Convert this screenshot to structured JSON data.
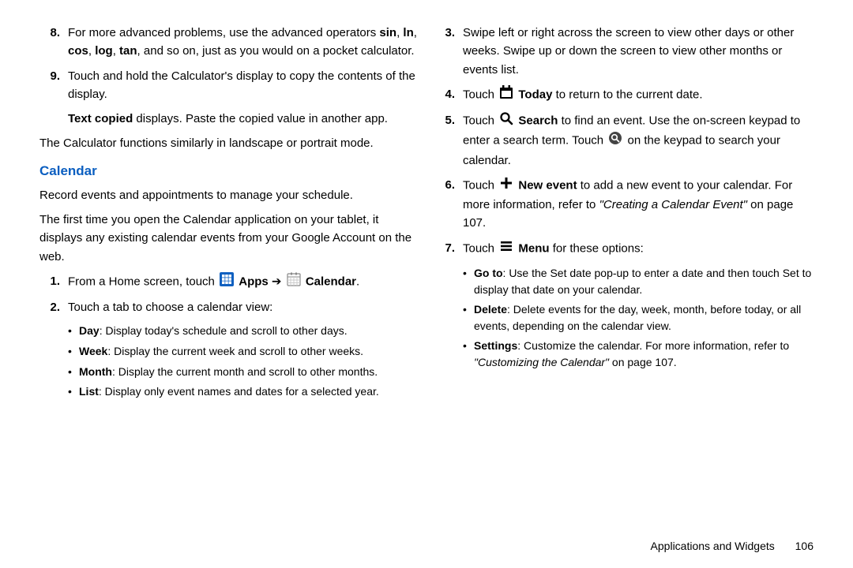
{
  "left": {
    "item8": {
      "num": "8.",
      "t1": "For more advanced problems, use the advanced operators ",
      "op1": "sin",
      "c1": ", ",
      "op2": "ln",
      "c2": ", ",
      "op3": "cos",
      "c3": ", ",
      "op4": "log",
      "c4": ", ",
      "op5": "tan",
      "t2": ", and so on, just as you would on a pocket calculator."
    },
    "item9": {
      "num": "9.",
      "text": "Touch and hold the Calculator's display to copy the contents of the display.",
      "sub_b": "Text copied",
      "sub_t": " displays. Paste the copied value in another app."
    },
    "landscape": "The Calculator functions similarly in landscape or portrait mode.",
    "heading": "Calendar",
    "desc1": "Record events and appointments to manage your schedule.",
    "desc2": "The first time you open the Calendar application on your tablet, it displays any existing calendar events from your Google Account on the web.",
    "step1": {
      "num": "1.",
      "t1": "From a Home screen, touch ",
      "apps": " Apps",
      "arrow": " ➔ ",
      "cal": " Calendar",
      "dot": "."
    },
    "step2": {
      "num": "2.",
      "text": "Touch a tab to choose a calendar view:"
    },
    "views": {
      "day_b": "Day",
      "day_t": ": Display today's schedule and scroll to other days.",
      "week_b": "Week",
      "week_t": ": Display the current week and scroll to other weeks.",
      "month_b": "Month",
      "month_t": ": Display the current month and scroll to other months.",
      "list_b": "List",
      "list_t": ": Display only event names and dates for a selected year."
    }
  },
  "right": {
    "step3": {
      "num": "3.",
      "text": "Swipe left or right across the screen to view other days or other weeks. Swipe up or down the screen to view other months or events list."
    },
    "step4": {
      "num": "4.",
      "t1": "Touch ",
      "b": " Today",
      "t2": " to return to the current date."
    },
    "step5": {
      "num": "5.",
      "t1": "Touch ",
      "b": " Search",
      "t2": " to find an event. Use the on-screen keypad to enter a search term. Touch ",
      "t3": " on the keypad to search your calendar."
    },
    "step6": {
      "num": "6.",
      "t1": "Touch ",
      "b": " New event",
      "t2": " to add a new event to your calendar. For more information, refer to ",
      "ref": "\"Creating a Calendar Event\"",
      "t3": " on page 107."
    },
    "step7": {
      "num": "7.",
      "t1": "Touch ",
      "b": " Menu",
      "t2": " for these options:"
    },
    "menu": {
      "goto_b": "Go to",
      "goto_t": ": Use the Set date pop-up to enter a date and then touch Set to display that date on your calendar.",
      "del_b": "Delete",
      "del_t": ": Delete events for the day, week, month, before today, or all events, depending on the calendar view.",
      "set_b": "Settings",
      "set_t": ": Customize the calendar. For more information, refer to ",
      "set_ref": "\"Customizing the Calendar\"",
      "set_t2": "  on page 107."
    }
  },
  "footer": {
    "section": "Applications and Widgets",
    "page": "106"
  }
}
